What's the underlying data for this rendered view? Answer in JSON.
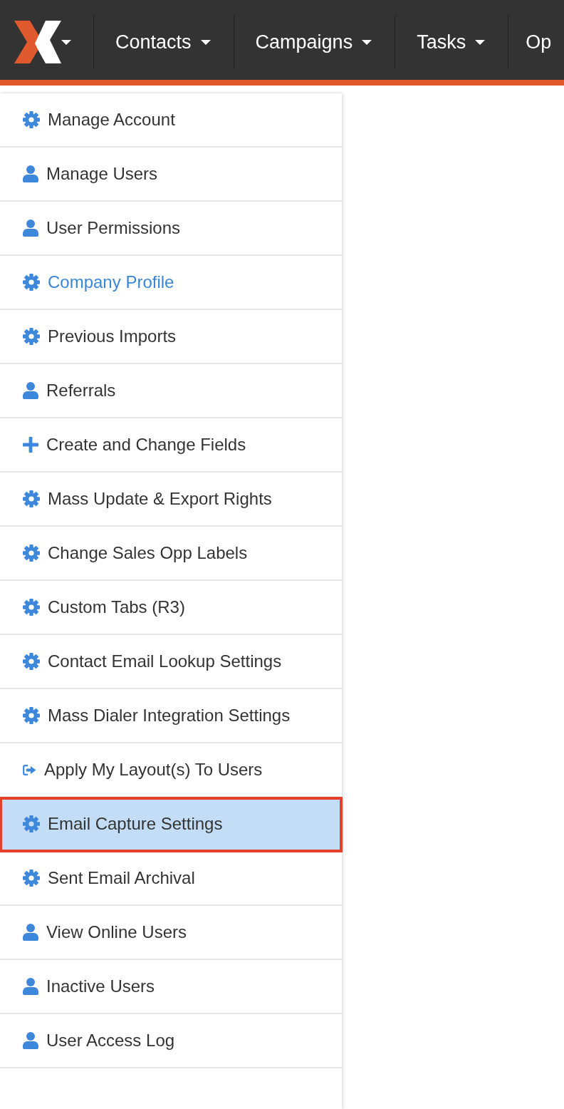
{
  "navbar": {
    "menus": [
      {
        "label": "Contacts",
        "caret": true
      },
      {
        "label": "Campaigns",
        "caret": true
      },
      {
        "label": "Tasks",
        "caret": true
      },
      {
        "label": "Op",
        "caret": false
      }
    ]
  },
  "sidebar": {
    "items": [
      {
        "label": "Manage Account",
        "kind": "gear",
        "selected": false,
        "highlighted": false
      },
      {
        "label": "Manage Users",
        "kind": "user",
        "selected": false,
        "highlighted": false
      },
      {
        "label": "User Permissions",
        "kind": "user",
        "selected": false,
        "highlighted": false
      },
      {
        "label": "Company Profile",
        "kind": "gear",
        "selected": true,
        "highlighted": false
      },
      {
        "label": "Previous Imports",
        "kind": "gear",
        "selected": false,
        "highlighted": false
      },
      {
        "label": "Referrals",
        "kind": "user",
        "selected": false,
        "highlighted": false
      },
      {
        "label": "Create and Change Fields",
        "kind": "plus",
        "selected": false,
        "highlighted": false
      },
      {
        "label": "Mass Update & Export Rights",
        "kind": "gear",
        "selected": false,
        "highlighted": false
      },
      {
        "label": "Change Sales Opp Labels",
        "kind": "gear",
        "selected": false,
        "highlighted": false
      },
      {
        "label": "Custom Tabs (R3)",
        "kind": "gear",
        "selected": false,
        "highlighted": false
      },
      {
        "label": "Contact Email Lookup Settings",
        "kind": "gear",
        "selected": false,
        "highlighted": false
      },
      {
        "label": "Mass Dialer Integration Settings",
        "kind": "gear",
        "selected": false,
        "highlighted": false
      },
      {
        "label": "Apply My Layout(s) To Users",
        "kind": "exit",
        "selected": false,
        "highlighted": false
      },
      {
        "label": "Email Capture Settings",
        "kind": "gear",
        "selected": false,
        "highlighted": true
      },
      {
        "label": "Sent Email Archival",
        "kind": "gear",
        "selected": false,
        "highlighted": false
      },
      {
        "label": "View Online Users",
        "kind": "user",
        "selected": false,
        "highlighted": false
      },
      {
        "label": "Inactive Users",
        "kind": "user",
        "selected": false,
        "highlighted": false
      },
      {
        "label": "User Access Log",
        "kind": "user",
        "selected": false,
        "highlighted": false
      }
    ]
  }
}
